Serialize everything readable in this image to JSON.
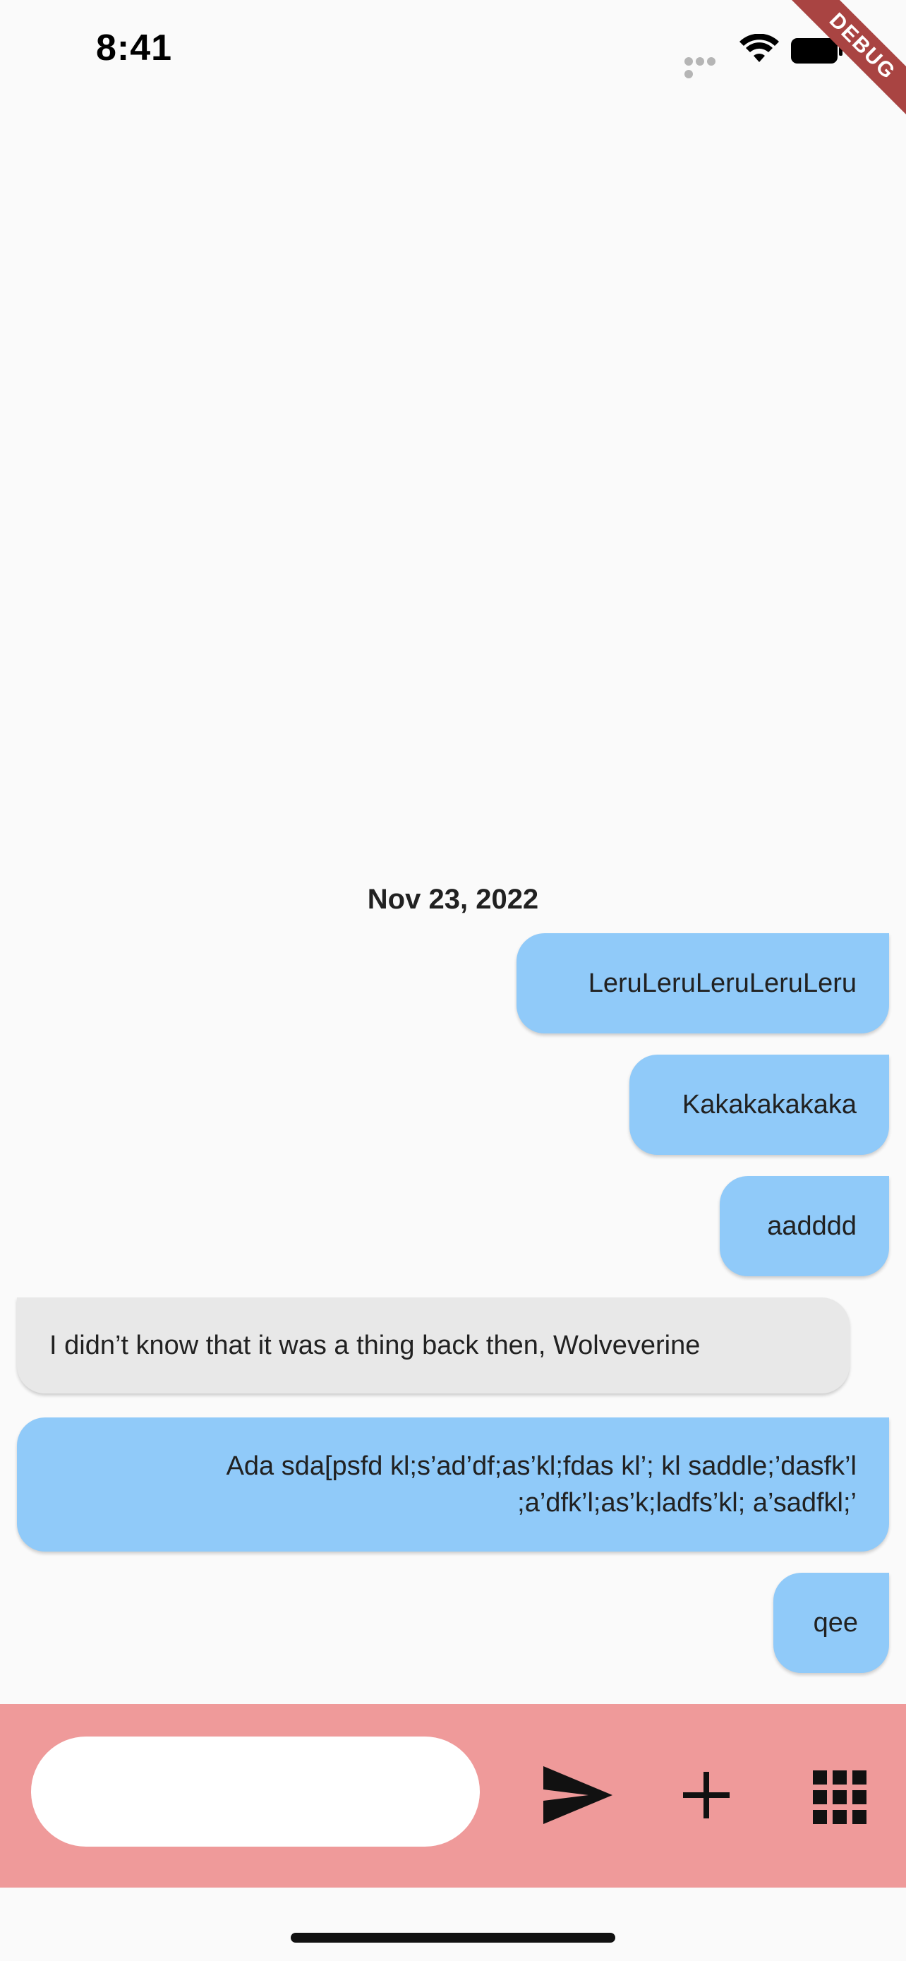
{
  "status_bar": {
    "time": "8:41",
    "icons": [
      "signal-dots-icon",
      "wifi-icon",
      "battery-icon"
    ]
  },
  "debug_banner": {
    "label": "DEBUG",
    "color": "#a94442"
  },
  "chat": {
    "date_header": "Nov 23, 2022",
    "messages": [
      {
        "sender": "me",
        "text": "LeruLeruLeruLeruLeru"
      },
      {
        "sender": "me",
        "text": "Kakakakakaka"
      },
      {
        "sender": "me",
        "text": "aadddd"
      },
      {
        "sender": "other",
        "text": "I didn’t know that it was a thing back then, Wolveverine"
      },
      {
        "sender": "me",
        "text": "Ada sda[psfd kl;s’ad’df;as’kl;fdas kl’; kl saddle;’dasfk’l ;a’dfk’l;as’k;ladfs’kl; a’sadfkl;’"
      },
      {
        "sender": "me",
        "text": "qee"
      }
    ]
  },
  "composer": {
    "input_value": "",
    "placeholder": "",
    "buttons": [
      "send-icon",
      "plus-icon",
      "apps-grid-icon"
    ]
  },
  "colors": {
    "sent_bubble": "#90caf9",
    "received_bubble": "#e8e8e8",
    "composer_bar": "#ef9a9a",
    "background": "#fafafa"
  }
}
